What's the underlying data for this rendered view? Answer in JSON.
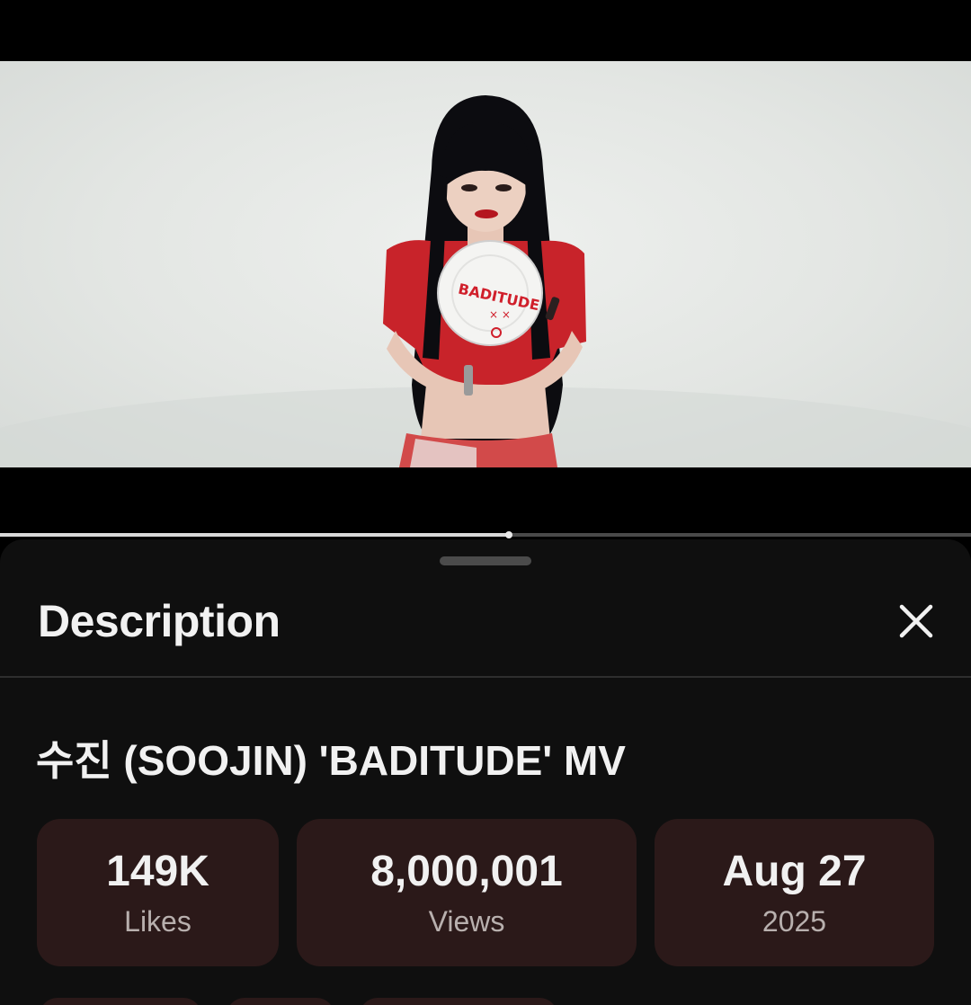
{
  "description_panel": {
    "title": "Description",
    "video_title": "수진 (SOOJIN) 'BADITUDE' MV",
    "stats": [
      {
        "value": "149K",
        "label": "Likes"
      },
      {
        "value": "8,000,001",
        "label": "Views"
      },
      {
        "value": "Aug 27",
        "label": "2025"
      }
    ]
  },
  "video": {
    "plate_text": "BADITUDE",
    "progress": 0.524
  },
  "colors": {
    "sheet_background": "#0f0f0f",
    "stat_card_background": "#2b1919",
    "text_primary": "#f1f1f1",
    "text_secondary": "#b8b0ae"
  },
  "icons": {
    "close": "close-icon"
  }
}
